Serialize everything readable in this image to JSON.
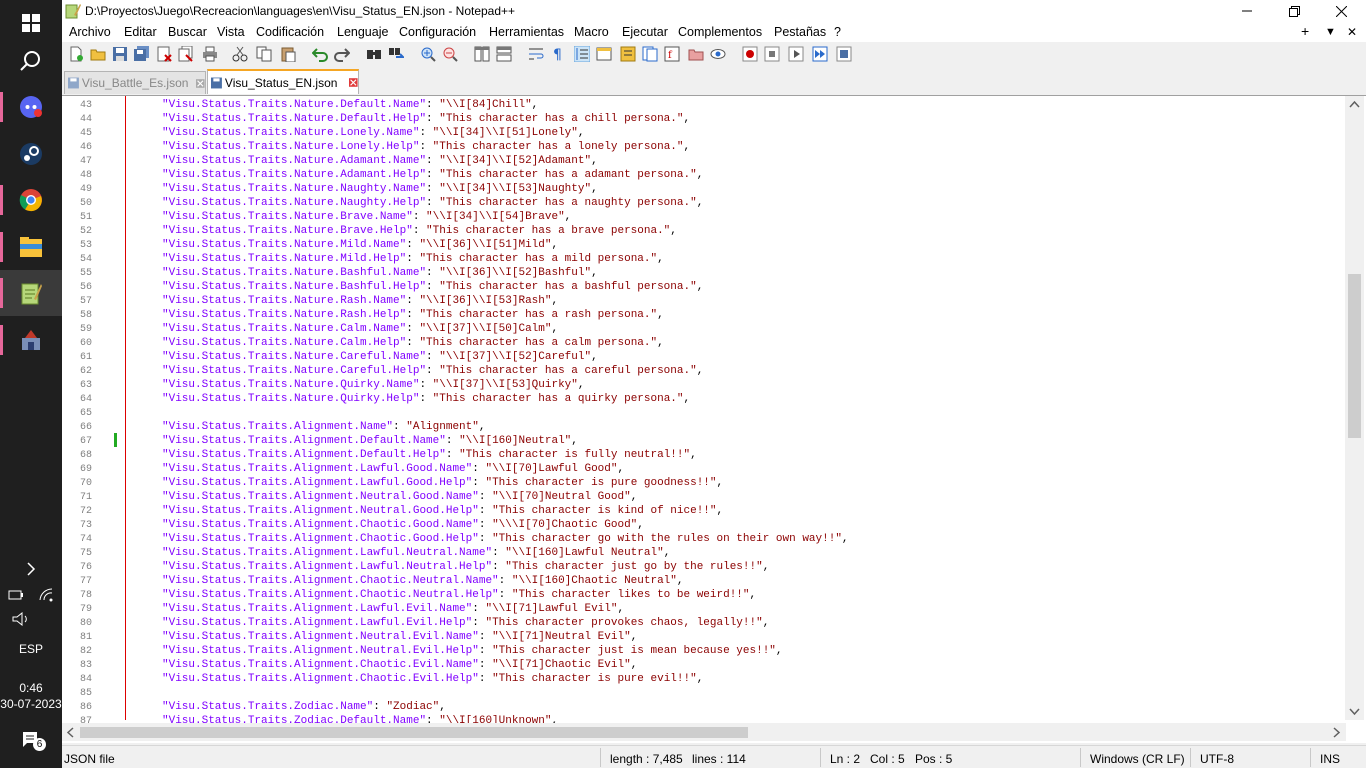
{
  "taskbar": {
    "apps": [
      {
        "name": "start-icon"
      },
      {
        "name": "search-icon"
      },
      {
        "name": "discord-icon"
      },
      {
        "name": "steam-icon"
      },
      {
        "name": "chrome-icon"
      },
      {
        "name": "file-explorer-icon"
      },
      {
        "name": "notepadpp-icon"
      },
      {
        "name": "game-maker-icon"
      }
    ],
    "language": "ESP",
    "time": "0:46",
    "date": "30-07-2023",
    "notifications_count": "6"
  },
  "window": {
    "title": "D:\\Proyectos\\Juego\\Recreacion\\languages\\en\\Visu_Status_EN.json - Notepad++"
  },
  "menu": [
    "Archivo",
    "Editar",
    "Buscar",
    "Vista",
    "Codificación",
    "Lenguaje",
    "Configuración",
    "Herramientas",
    "Macro",
    "Ejecutar",
    "Complementos",
    "Pestañas",
    "?"
  ],
  "menu_right": {
    "plus": "+",
    "dropdown": "▼",
    "close": "✕"
  },
  "tabs": [
    {
      "label": "Visu_Battle_Es.json",
      "active": false
    },
    {
      "label": "Visu_Status_EN.json",
      "active": true
    }
  ],
  "lines": [
    {
      "n": "43",
      "k": "\"Visu.Status.Traits.Nature.Default.Name\"",
      "v": "\"\\\\I[84]Chill\""
    },
    {
      "n": "44",
      "k": "\"Visu.Status.Traits.Nature.Default.Help\"",
      "v": "\"This character has a chill persona.\""
    },
    {
      "n": "45",
      "k": "\"Visu.Status.Traits.Nature.Lonely.Name\"",
      "v": "\"\\\\I[34]\\\\I[51]Lonely\""
    },
    {
      "n": "46",
      "k": "\"Visu.Status.Traits.Nature.Lonely.Help\"",
      "v": "\"This character has a lonely persona.\""
    },
    {
      "n": "47",
      "k": "\"Visu.Status.Traits.Nature.Adamant.Name\"",
      "v": "\"\\\\I[34]\\\\I[52]Adamant\""
    },
    {
      "n": "48",
      "k": "\"Visu.Status.Traits.Nature.Adamant.Help\"",
      "v": "\"This character has a adamant persona.\""
    },
    {
      "n": "49",
      "k": "\"Visu.Status.Traits.Nature.Naughty.Name\"",
      "v": "\"\\\\I[34]\\\\I[53]Naughty\""
    },
    {
      "n": "50",
      "k": "\"Visu.Status.Traits.Nature.Naughty.Help\"",
      "v": "\"This character has a naughty persona.\""
    },
    {
      "n": "51",
      "k": "\"Visu.Status.Traits.Nature.Brave.Name\"",
      "v": "\"\\\\I[34]\\\\I[54]Brave\""
    },
    {
      "n": "52",
      "k": "\"Visu.Status.Traits.Nature.Brave.Help\"",
      "v": "\"This character has a brave persona.\""
    },
    {
      "n": "53",
      "k": "\"Visu.Status.Traits.Nature.Mild.Name\"",
      "v": "\"\\\\I[36]\\\\I[51]Mild\""
    },
    {
      "n": "54",
      "k": "\"Visu.Status.Traits.Nature.Mild.Help\"",
      "v": "\"This character has a mild persona.\""
    },
    {
      "n": "55",
      "k": "\"Visu.Status.Traits.Nature.Bashful.Name\"",
      "v": "\"\\\\I[36]\\\\I[52]Bashful\""
    },
    {
      "n": "56",
      "k": "\"Visu.Status.Traits.Nature.Bashful.Help\"",
      "v": "\"This character has a bashful persona.\""
    },
    {
      "n": "57",
      "k": "\"Visu.Status.Traits.Nature.Rash.Name\"",
      "v": "\"\\\\I[36]\\\\I[53]Rash\""
    },
    {
      "n": "58",
      "k": "\"Visu.Status.Traits.Nature.Rash.Help\"",
      "v": "\"This character has a rash persona.\""
    },
    {
      "n": "59",
      "k": "\"Visu.Status.Traits.Nature.Calm.Name\"",
      "v": "\"\\\\I[37]\\\\I[50]Calm\""
    },
    {
      "n": "60",
      "k": "\"Visu.Status.Traits.Nature.Calm.Help\"",
      "v": "\"This character has a calm persona.\""
    },
    {
      "n": "61",
      "k": "\"Visu.Status.Traits.Nature.Careful.Name\"",
      "v": "\"\\\\I[37]\\\\I[52]Careful\""
    },
    {
      "n": "62",
      "k": "\"Visu.Status.Traits.Nature.Careful.Help\"",
      "v": "\"This character has a careful persona.\""
    },
    {
      "n": "63",
      "k": "\"Visu.Status.Traits.Nature.Quirky.Name\"",
      "v": "\"\\\\I[37]\\\\I[53]Quirky\""
    },
    {
      "n": "64",
      "k": "\"Visu.Status.Traits.Nature.Quirky.Help\"",
      "v": "\"This character has a quirky persona.\""
    },
    {
      "n": "65",
      "k": "",
      "v": ""
    },
    {
      "n": "66",
      "k": "\"Visu.Status.Traits.Alignment.Name\"",
      "v": "\"Alignment\""
    },
    {
      "n": "67",
      "k": "\"Visu.Status.Traits.Alignment.Default.Name\"",
      "v": "\"\\\\I[160]Neutral\""
    },
    {
      "n": "68",
      "k": "\"Visu.Status.Traits.Alignment.Default.Help\"",
      "v": "\"This character is fully neutral!!\""
    },
    {
      "n": "69",
      "k": "\"Visu.Status.Traits.Alignment.Lawful.Good.Name\"",
      "v": "\"\\\\I[70]Lawful Good\""
    },
    {
      "n": "70",
      "k": "\"Visu.Status.Traits.Alignment.Lawful.Good.Help\"",
      "v": "\"This character is pure goodness!!\""
    },
    {
      "n": "71",
      "k": "\"Visu.Status.Traits.Alignment.Neutral.Good.Name\"",
      "v": "\"\\\\I[70]Neutral Good\""
    },
    {
      "n": "72",
      "k": "\"Visu.Status.Traits.Alignment.Neutral.Good.Help\"",
      "v": "\"This character is kind of nice!!\""
    },
    {
      "n": "73",
      "k": "\"Visu.Status.Traits.Alignment.Chaotic.Good.Name\"",
      "v": "\"\\\\\\I[70]Chaotic Good\""
    },
    {
      "n": "74",
      "k": "\"Visu.Status.Traits.Alignment.Chaotic.Good.Help\"",
      "v": "\"This character go with the rules on their own way!!\""
    },
    {
      "n": "75",
      "k": "\"Visu.Status.Traits.Alignment.Lawful.Neutral.Name\"",
      "v": "\"\\\\I[160]Lawful Neutral\""
    },
    {
      "n": "76",
      "k": "\"Visu.Status.Traits.Alignment.Lawful.Neutral.Help\"",
      "v": "\"This character just go by the rules!!\""
    },
    {
      "n": "77",
      "k": "\"Visu.Status.Traits.Alignment.Chaotic.Neutral.Name\"",
      "v": "\"\\\\I[160]Chaotic Neutral\""
    },
    {
      "n": "78",
      "k": "\"Visu.Status.Traits.Alignment.Chaotic.Neutral.Help\"",
      "v": "\"This character likes to be weird!!\""
    },
    {
      "n": "79",
      "k": "\"Visu.Status.Traits.Alignment.Lawful.Evil.Name\"",
      "v": "\"\\\\I[71]Lawful Evil\""
    },
    {
      "n": "80",
      "k": "\"Visu.Status.Traits.Alignment.Lawful.Evil.Help\"",
      "v": "\"This character provokes chaos, legally!!\""
    },
    {
      "n": "81",
      "k": "\"Visu.Status.Traits.Alignment.Neutral.Evil.Name\"",
      "v": "\"\\\\I[71]Neutral Evil\""
    },
    {
      "n": "82",
      "k": "\"Visu.Status.Traits.Alignment.Neutral.Evil.Help\"",
      "v": "\"This character just is mean because yes!!\""
    },
    {
      "n": "83",
      "k": "\"Visu.Status.Traits.Alignment.Chaotic.Evil.Name\"",
      "v": "\"\\\\I[71]Chaotic Evil\""
    },
    {
      "n": "84",
      "k": "\"Visu.Status.Traits.Alignment.Chaotic.Evil.Help\"",
      "v": "\"This character is pure evil!!\""
    },
    {
      "n": "85",
      "k": "",
      "v": ""
    },
    {
      "n": "86",
      "k": "\"Visu.Status.Traits.Zodiac.Name\"",
      "v": "\"Zodiac\""
    },
    {
      "n": "87",
      "k": "\"Visu.Status.Traits.Zodiac.Default.Name\"",
      "v": "\"\\\\I[160]Unknown\""
    }
  ],
  "status": {
    "file_type": "JSON file",
    "length": "length : 7,485",
    "lines": "lines : 114",
    "ln": "Ln : 2",
    "col": "Col : 5",
    "pos": "Pos : 5",
    "eol": "Windows (CR LF)",
    "encoding": "UTF-8",
    "mode": "INS"
  },
  "colors": {
    "key": "#8000ff",
    "value": "#8b0000",
    "operator": "#000000",
    "fold_line": "#dd0000",
    "change_marker": "#22aa22"
  }
}
